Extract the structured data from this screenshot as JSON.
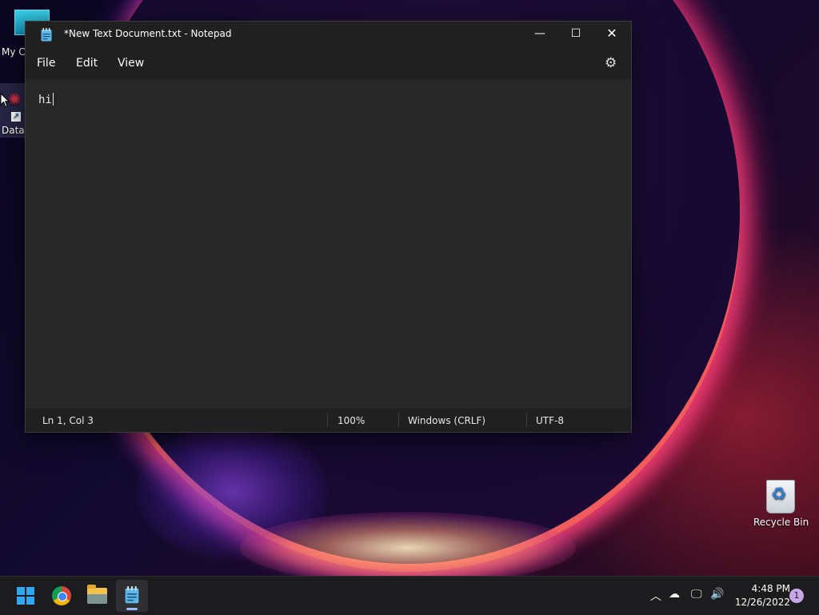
{
  "desktop": {
    "icons": [
      {
        "label": "My Co"
      },
      {
        "label": "DataW"
      },
      {
        "label": "Recycle Bin"
      }
    ]
  },
  "window": {
    "title": "*New Text Document.txt - Notepad",
    "controls": {
      "minimize": "—",
      "maximize": "☐",
      "close": "✕"
    },
    "menu": [
      "File",
      "Edit",
      "View"
    ],
    "settings_icon": "gear-icon",
    "content": "hi",
    "status": {
      "position": "Ln 1, Col 3",
      "zoom": "100%",
      "line_ending": "Windows (CRLF)",
      "encoding": "UTF-8"
    }
  },
  "taskbar": {
    "apps": [
      "start-icon",
      "chrome-icon",
      "file-explorer-icon",
      "notepad-icon"
    ],
    "active_app": "notepad",
    "tray_icons": [
      "chevron-up-icon",
      "onedrive-offline-icon",
      "network-icon",
      "volume-icon"
    ],
    "time": "4:48 PM",
    "date": "12/26/2022",
    "notification_count": "1"
  },
  "colors": {
    "window_bg": "#272727",
    "titlebar_bg": "#202020",
    "taskbar_bg": "#1c1c1e",
    "accent": "#31a8f5"
  }
}
